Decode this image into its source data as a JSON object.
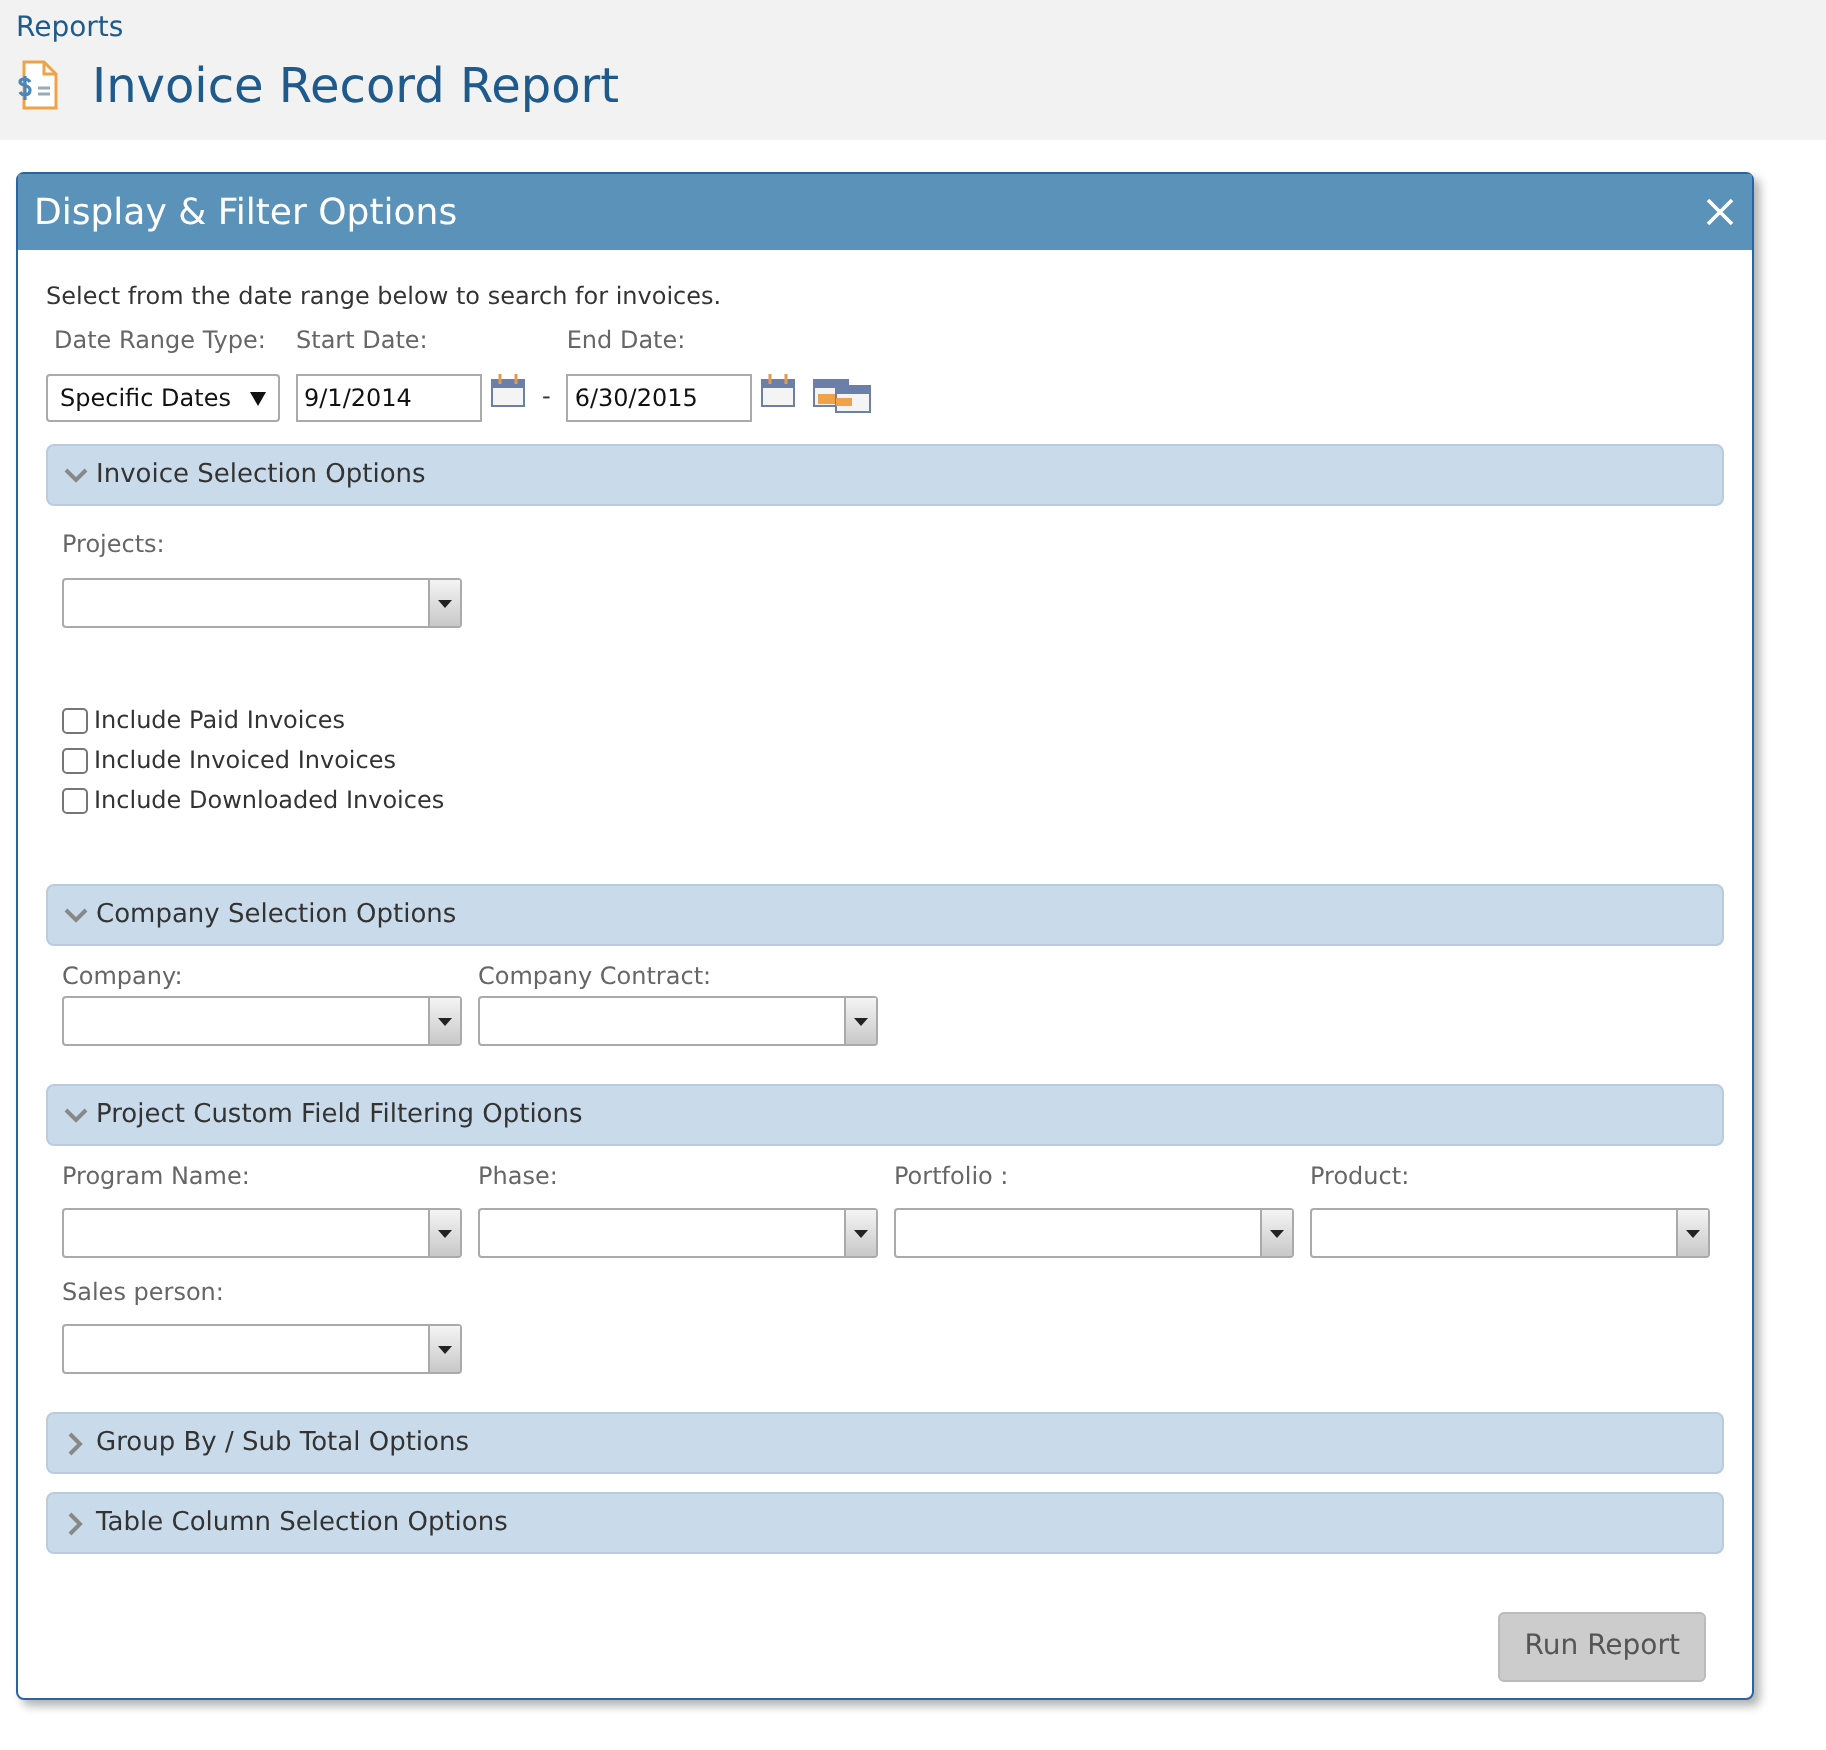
{
  "breadcrumb": "Reports",
  "page_title": "Invoice Record Report",
  "panel": {
    "title": "Display & Filter Options",
    "intro": "Select from the date range below to search for invoices.",
    "date_range": {
      "type_label": "Date Range Type:",
      "type_value": "Specific Dates",
      "start_label": "Start Date:",
      "start_value": "9/1/2014",
      "separator": "-",
      "end_label": "End Date:",
      "end_value": "6/30/2015"
    },
    "sections": [
      {
        "title": "Invoice Selection Options",
        "expanded": true,
        "fields": [
          {
            "label": "Projects:"
          }
        ],
        "checkboxes": [
          {
            "label": "Include Paid Invoices",
            "checked": false
          },
          {
            "label": "Include Invoiced Invoices",
            "checked": false
          },
          {
            "label": "Include Downloaded Invoices",
            "checked": false
          }
        ]
      },
      {
        "title": "Company Selection Options",
        "expanded": true,
        "fields": [
          {
            "label": "Company:"
          },
          {
            "label": "Company Contract:"
          }
        ]
      },
      {
        "title": "Project Custom Field Filtering Options",
        "expanded": true,
        "fields": [
          {
            "label": "Program Name:"
          },
          {
            "label": "Phase:"
          },
          {
            "label": "Portfolio :"
          },
          {
            "label": "Product:"
          },
          {
            "label": "Sales person:"
          }
        ]
      },
      {
        "title": "Group By / Sub Total Options",
        "expanded": false
      },
      {
        "title": "Table Column Selection Options",
        "expanded": false
      }
    ],
    "run_button": "Run Report"
  }
}
